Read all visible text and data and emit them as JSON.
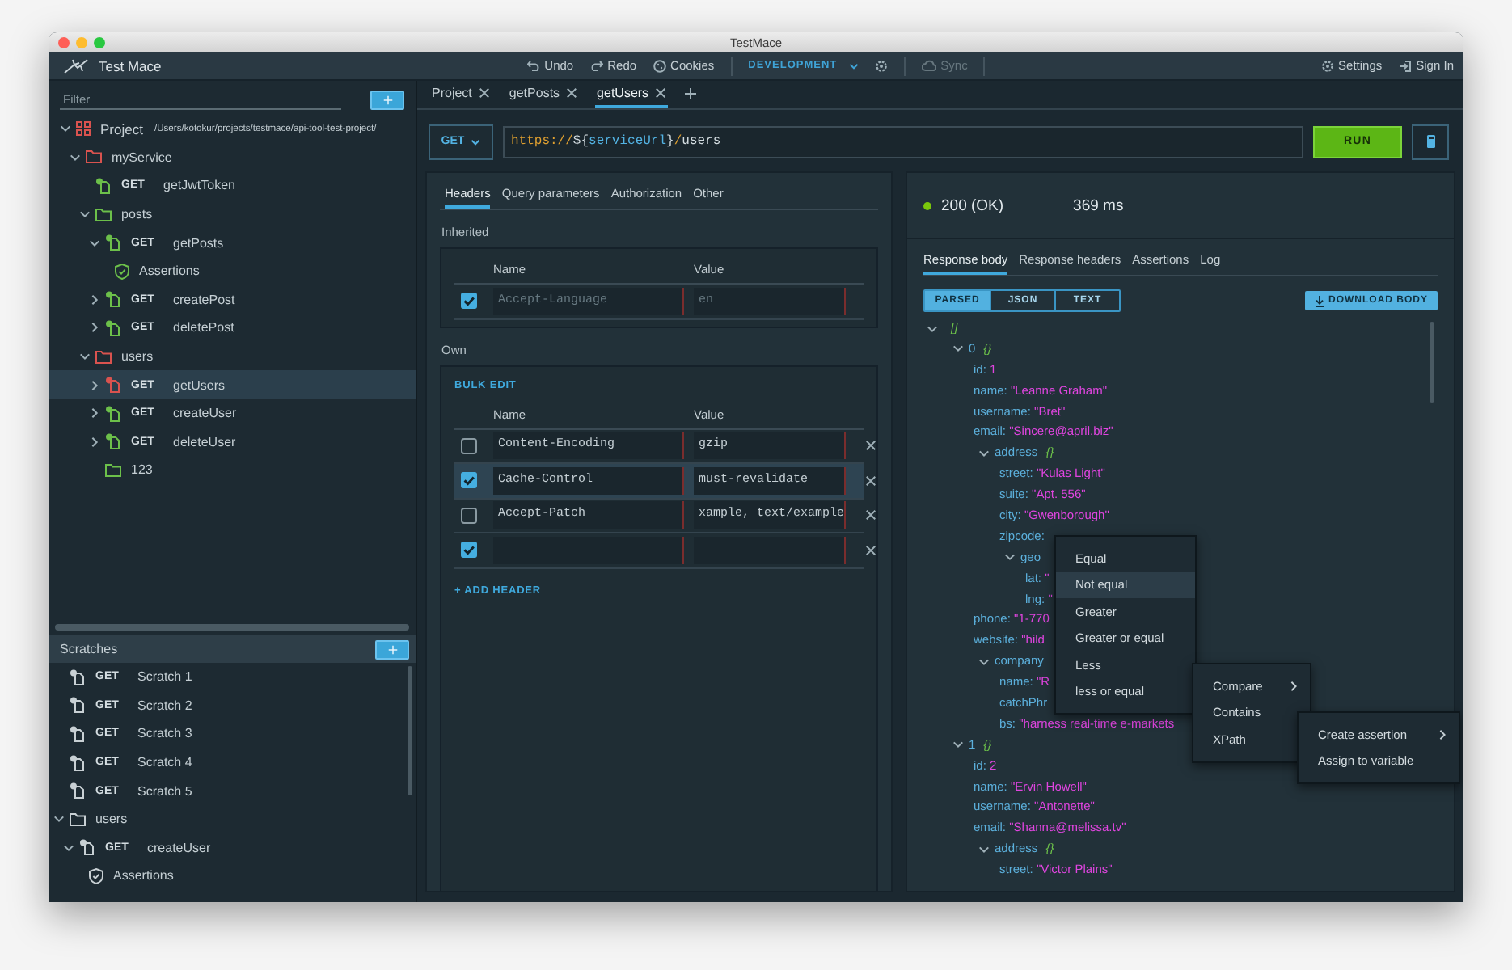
{
  "window": {
    "title": "TestMace"
  },
  "toolbar": {
    "app_name": "Test Mace",
    "undo": "Undo",
    "redo": "Redo",
    "cookies": "Cookies",
    "environment": "DEVELOPMENT",
    "sync": {
      "label": "Sync",
      "disabled": true
    },
    "settings": "Settings",
    "sign_in": "Sign In"
  },
  "sidebar": {
    "filter_placeholder": "Filter",
    "tree": [
      {
        "kind": "project",
        "label": "Project",
        "path": "/Users/kotokur/projects/testmace/api-tool-test-project/",
        "color": "#d9534f",
        "expanded": true,
        "selected": false,
        "children": [
          {
            "kind": "folder",
            "label": "myService",
            "color": "#d9534f",
            "expanded": true,
            "selected": false,
            "children": [
              {
                "kind": "request",
                "method": "GET",
                "label": "getJwtToken",
                "color": "#6cc04a",
                "selected": false
              },
              {
                "kind": "folder",
                "label": "posts",
                "color": "#6cc04a",
                "expanded": true,
                "selected": false,
                "children": [
                  {
                    "kind": "request",
                    "method": "GET",
                    "label": "getPosts",
                    "color": "#6cc04a",
                    "expanded": true,
                    "selected": false,
                    "children": [
                      {
                        "kind": "assertions",
                        "label": "Assertions",
                        "color": "#6cc04a",
                        "selected": false
                      }
                    ]
                  },
                  {
                    "kind": "request",
                    "method": "GET",
                    "label": "createPost",
                    "color": "#6cc04a",
                    "expanded": false,
                    "selected": false
                  },
                  {
                    "kind": "request",
                    "method": "GET",
                    "label": "deletePost",
                    "color": "#6cc04a",
                    "expanded": false,
                    "selected": false
                  }
                ]
              },
              {
                "kind": "folder",
                "label": "users",
                "color": "#d9534f",
                "expanded": true,
                "selected": false,
                "children": [
                  {
                    "kind": "request",
                    "method": "GET",
                    "label": "getUsers",
                    "color": "#d9534f",
                    "expanded": false,
                    "selected": true
                  },
                  {
                    "kind": "request",
                    "method": "GET",
                    "label": "createUser",
                    "color": "#6cc04a",
                    "expanded": false,
                    "selected": false
                  },
                  {
                    "kind": "request",
                    "method": "GET",
                    "label": "deleteUser",
                    "color": "#6cc04a",
                    "expanded": false,
                    "selected": false
                  },
                  {
                    "kind": "folder",
                    "label": "123",
                    "color": "#6cc04a",
                    "selected": false
                  }
                ]
              }
            ]
          }
        ]
      }
    ],
    "scratches": {
      "title": "Scratches",
      "items": [
        {
          "kind": "request",
          "method": "GET",
          "label": "Scratch 1",
          "color": "#c8d0d4",
          "selected": false
        },
        {
          "kind": "request",
          "method": "GET",
          "label": "Scratch 2",
          "color": "#c8d0d4",
          "selected": false
        },
        {
          "kind": "request",
          "method": "GET",
          "label": "Scratch 3",
          "color": "#c8d0d4",
          "selected": false
        },
        {
          "kind": "request",
          "method": "GET",
          "label": "Scratch 4",
          "color": "#c8d0d4",
          "selected": false
        },
        {
          "kind": "request",
          "method": "GET",
          "label": "Scratch 5",
          "color": "#c8d0d4",
          "selected": false
        },
        {
          "kind": "folder",
          "label": "users",
          "color": "#c8d0d4",
          "expanded": true,
          "selected": false,
          "children": [
            {
              "kind": "request",
              "method": "GET",
              "label": "createUser",
              "color": "#c8d0d4",
              "expanded": true,
              "selected": false,
              "children": [
                {
                  "kind": "assertions",
                  "label": "Assertions",
                  "color": "#c8d0d4",
                  "selected": false
                }
              ]
            }
          ]
        }
      ]
    }
  },
  "tabs": [
    {
      "label": "Project",
      "selected": false
    },
    {
      "label": "getPosts",
      "selected": false
    },
    {
      "label": "getUsers",
      "selected": true
    }
  ],
  "request": {
    "method": "GET",
    "url": [
      {
        "text": "https://",
        "kind": "protocol"
      },
      {
        "text": "${",
        "kind": "plain"
      },
      {
        "text": "serviceUrl",
        "kind": "variable"
      },
      {
        "text": "}",
        "kind": "plain"
      },
      {
        "text": "/",
        "kind": "protocol"
      },
      {
        "text": "users",
        "kind": "plain"
      }
    ],
    "run": "RUN",
    "tabs": [
      {
        "label": "Headers",
        "selected": true
      },
      {
        "label": "Query parameters",
        "selected": false
      },
      {
        "label": "Authorization",
        "selected": false
      },
      {
        "label": "Other",
        "selected": false
      }
    ],
    "inherited": {
      "title": "Inherited",
      "columns": [
        "Name",
        "Value"
      ],
      "rows": [
        {
          "checked": true,
          "disabled": true,
          "name": "Accept-Language",
          "value": "en"
        }
      ]
    },
    "own": {
      "title": "Own",
      "bulk_edit": "BULK EDIT",
      "columns": [
        "Name",
        "Value"
      ],
      "rows": [
        {
          "checked": false,
          "selected": false,
          "name": "Content-Encoding",
          "value": "gzip"
        },
        {
          "checked": true,
          "selected": true,
          "name": "Cache-Control",
          "value": "must-revalidate"
        },
        {
          "checked": false,
          "selected": false,
          "name": "Accept-Patch",
          "value": "xample, text/example"
        },
        {
          "checked": true,
          "selected": false
        }
      ],
      "add_header": "+ ADD HEADER"
    }
  },
  "response": {
    "status": {
      "text": "200 (OK)",
      "color": "#7ac70c"
    },
    "time": "369 ms",
    "tabs": [
      {
        "label": "Response body",
        "selected": true
      },
      {
        "label": "Response headers",
        "selected": false
      },
      {
        "label": "Assertions",
        "selected": false
      },
      {
        "label": "Log",
        "selected": false
      }
    ],
    "formats": [
      {
        "label": "PARSED",
        "selected": true
      },
      {
        "label": "JSON",
        "selected": false
      },
      {
        "label": "TEXT",
        "selected": false
      }
    ],
    "download": "DOWNLOAD BODY",
    "body": [
      {
        "marker": "[]",
        "expanded": true,
        "children": [
          {
            "key": "0",
            "marker": "{}",
            "expanded": true,
            "children": [
              {
                "key": "id:",
                "value": "1"
              },
              {
                "key": "name:",
                "value": "\"Leanne Graham\""
              },
              {
                "key": "username:",
                "value": "\"Bret\""
              },
              {
                "key": "email:",
                "value": "\"Sincere@april.biz\""
              },
              {
                "key": "address",
                "marker": "{}",
                "expanded": true,
                "children": [
                  {
                    "key": "street:",
                    "value": "\"Kulas Light\""
                  },
                  {
                    "key": "suite:",
                    "value": "\"Apt. 556\""
                  },
                  {
                    "key": "city:",
                    "value": "\"Gwenborough\""
                  },
                  {
                    "key": "zipcode:"
                  },
                  {
                    "key": "geo",
                    "expanded": true,
                    "children": [
                      {
                        "key": "lat:",
                        "value": "\""
                      },
                      {
                        "key": "lng:",
                        "value": "\""
                      }
                    ]
                  }
                ]
              },
              {
                "key": "phone:",
                "value": "\"1-770"
              },
              {
                "key": "website:",
                "value": "\"hild"
              },
              {
                "key": "company",
                "expanded": true,
                "children": [
                  {
                    "key": "name:",
                    "value": "\"R"
                  },
                  {
                    "key": "catchPhr"
                  },
                  {
                    "key": "bs:",
                    "value": "\"harness real-time e-markets"
                  }
                ]
              }
            ]
          },
          {
            "key": "1",
            "marker": "{}",
            "expanded": true,
            "children": [
              {
                "key": "id:",
                "value": "2"
              },
              {
                "key": "name:",
                "value": "\"Ervin Howell\""
              },
              {
                "key": "username:",
                "value": "\"Antonette\""
              },
              {
                "key": "email:",
                "value": "\"Shanna@melissa.tv\""
              },
              {
                "key": "address",
                "marker": "{}",
                "expanded": true,
                "children": [
                  {
                    "key": "street:",
                    "value": "\"Victor Plains\""
                  }
                ]
              }
            ]
          }
        ]
      }
    ]
  },
  "context_menus": [
    {
      "items": [
        {
          "label": "Equal",
          "selected": false
        },
        {
          "label": "Not equal",
          "selected": true
        },
        {
          "label": "Greater",
          "selected": false
        },
        {
          "label": "Greater or equal",
          "selected": false
        },
        {
          "label": "Less",
          "selected": false
        },
        {
          "label": "less or equal",
          "selected": false
        }
      ]
    },
    {
      "items": [
        {
          "label": "Compare",
          "submenu": true,
          "selected": false
        },
        {
          "label": "Contains",
          "submenu": false,
          "selected": false
        },
        {
          "label": "XPath",
          "submenu": false,
          "selected": false
        }
      ]
    },
    {
      "items": [
        {
          "label": "Create assertion",
          "submenu": true,
          "selected": false
        },
        {
          "label": "Assign to variable",
          "submenu": false,
          "selected": false
        }
      ]
    }
  ]
}
